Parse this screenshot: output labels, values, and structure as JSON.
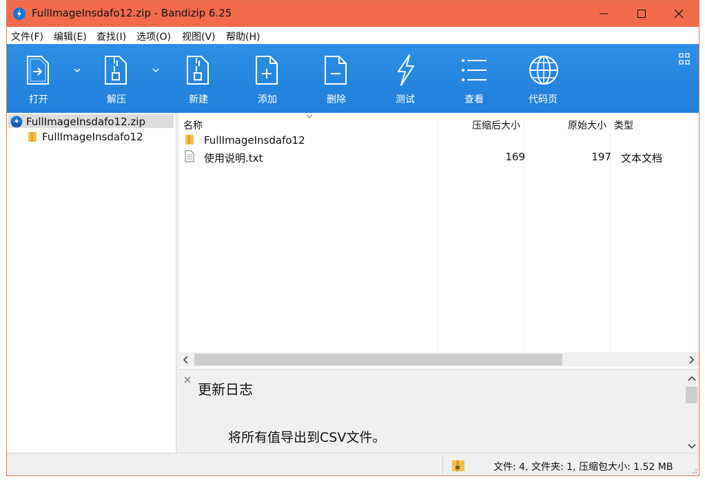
{
  "window": {
    "title": "FullImageInsdafo12.zip - Bandizip 6.25"
  },
  "menu": [
    {
      "label": "文件(F)"
    },
    {
      "label": "编辑(E)"
    },
    {
      "label": "查找(I)"
    },
    {
      "label": "选项(O)"
    },
    {
      "label": "视图(V)"
    },
    {
      "label": "帮助(H)"
    }
  ],
  "toolbar": {
    "open": "打开",
    "extract": "解压",
    "new": "新建",
    "add": "添加",
    "delete": "删除",
    "test": "测试",
    "view": "查看",
    "codepage": "代码页"
  },
  "tree": {
    "root": "FullImageInsdafo12.zip",
    "child": "FullImageInsdafo12"
  },
  "list": {
    "headers": {
      "name": "名称",
      "compressed": "压缩后大小",
      "original": "原始大小",
      "type": "类型"
    },
    "rows": [
      {
        "name": "FullImageInsdafo12",
        "compressed": "",
        "original": "",
        "type": ""
      },
      {
        "name": "使用说明.txt",
        "compressed": "169",
        "original": "197",
        "type": "文本文档"
      }
    ]
  },
  "preview": {
    "title": "更新日志",
    "line": "将所有值导出到CSV文件。"
  },
  "status": {
    "text": "文件: 4, 文件夹: 1, 压缩包大小: 1.52 MB"
  },
  "colors": {
    "titlebar": "#f26b4c",
    "toolbar": "#1f7fd9",
    "accent": "#1a73d1"
  }
}
